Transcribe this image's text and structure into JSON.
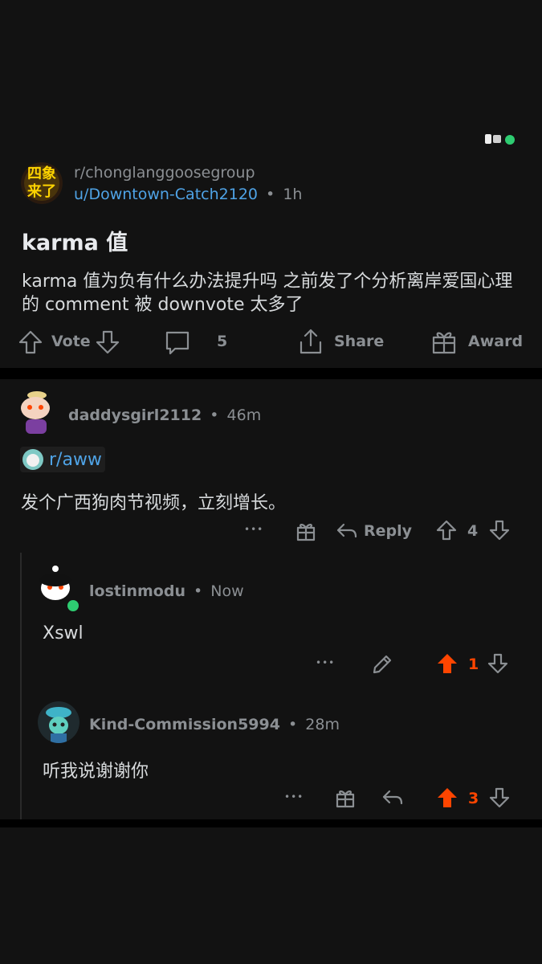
{
  "post": {
    "subreddit": "r/chonglanggoosegroup",
    "author": "u/Downtown-Catch2120",
    "time": "1h",
    "title": "karma 值",
    "body": "karma 值为负有什么办法提升吗 之前发了个分析离岸爱国心理的 comment 被 downvote 太多了",
    "icon_text": "四象来了",
    "actions": {
      "vote": "Vote",
      "comments": "5",
      "share": "Share",
      "award": "Award"
    }
  },
  "comments": [
    {
      "author": "daddysgirl2112",
      "time": "46m",
      "link": "r/aww",
      "body": "发个广西狗肉节视频，立刻增长。",
      "reply": "Reply",
      "votes": "4"
    },
    {
      "author": "lostinmodu",
      "time": "Now",
      "body": "Xswl",
      "votes": "1"
    },
    {
      "author": "Kind-Commission5994",
      "time": "28m",
      "body": "听我说谢谢你",
      "votes": "3"
    }
  ],
  "separator": "•",
  "more": "•••",
  "colors": {
    "upvoted": "#ff4500",
    "link": "#4fa3e6",
    "online": "#2ecc71"
  }
}
